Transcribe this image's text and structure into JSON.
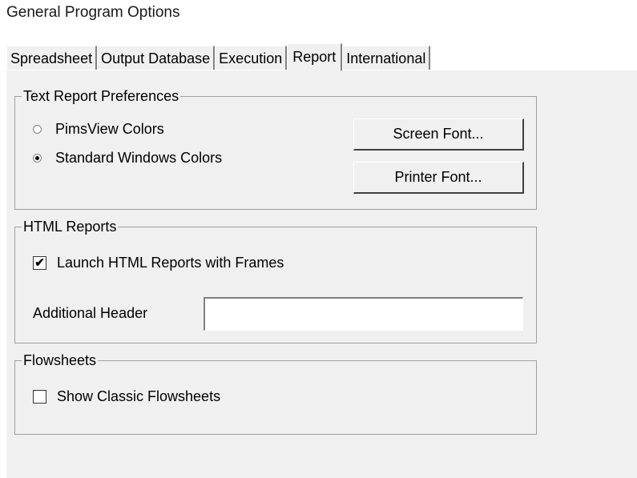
{
  "dialog": {
    "title": "General Program Options"
  },
  "tabs": [
    {
      "label": "Spreadsheet"
    },
    {
      "label": "Output Database"
    },
    {
      "label": "Execution"
    },
    {
      "label": "Report",
      "active": true
    },
    {
      "label": "International"
    }
  ],
  "text_report": {
    "group_label": "Text Report Preferences",
    "radio_pimsview": {
      "label": "PimsView Colors",
      "checked": false
    },
    "radio_standard": {
      "label": "Standard Windows Colors",
      "checked": true
    },
    "screen_font_button": "Screen Font...",
    "printer_font_button": "Printer Font..."
  },
  "html_reports": {
    "group_label": "HTML Reports",
    "launch_frames": {
      "label": "Launch HTML Reports with Frames",
      "checked": true
    },
    "additional_header": {
      "label": "Additional Header",
      "value": ""
    }
  },
  "flowsheets": {
    "group_label": "Flowsheets",
    "show_classic": {
      "label": "Show Classic Flowsheets",
      "checked": false
    }
  }
}
